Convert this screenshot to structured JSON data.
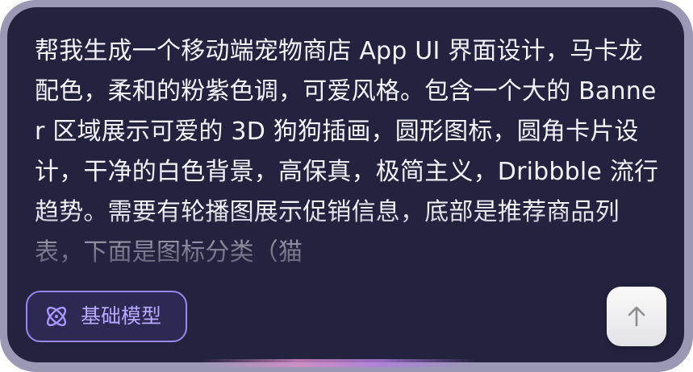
{
  "composer": {
    "prompt_text": "帮我生成一个移动端宠物商店 App UI 界面设计，马卡龙配色，柔和的粉紫色调，可爱风格。包含一个大的 Banner 区域展示可爱的 3D 狗狗插画，圆形图标，圆角卡片设计，干净的白色背景，高保真，极简主义，Dribbble 流行趋势。需要有轮播图展示促销信息，底部是推荐商品列表，下面是图标分类（猫"
  },
  "model_selector": {
    "label": "基础模型",
    "icon": "atom-icon",
    "color": "#9a86f0"
  },
  "send_button": {
    "icon": "arrow-up-icon"
  },
  "colors": {
    "panel_background": "#23223f",
    "frame": "#9b98b6",
    "text": "#f4f3fb",
    "accent": "#b9a9ff"
  }
}
